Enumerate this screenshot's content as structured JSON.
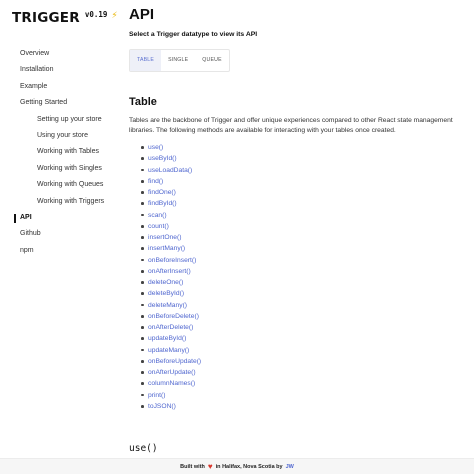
{
  "brand": {
    "name": "TRIGGER",
    "version": "v0.19",
    "icon": "lightning-bolt-icon",
    "icon_glyph": "⚡"
  },
  "sidebar": {
    "items": [
      {
        "label": "Overview",
        "level": "top",
        "active": false
      },
      {
        "label": "Installation",
        "level": "top",
        "active": false
      },
      {
        "label": "Example",
        "level": "top",
        "active": false
      },
      {
        "label": "Getting Started",
        "level": "top",
        "active": false
      },
      {
        "label": "Setting up your store",
        "level": "sub",
        "active": false
      },
      {
        "label": "Using your store",
        "level": "sub",
        "active": false
      },
      {
        "label": "Working with Tables",
        "level": "sub",
        "active": false
      },
      {
        "label": "Working with Singles",
        "level": "sub",
        "active": false
      },
      {
        "label": "Working with Queues",
        "level": "sub",
        "active": false
      },
      {
        "label": "Working with Triggers",
        "level": "sub",
        "active": false
      },
      {
        "label": "API",
        "level": "top",
        "active": true
      },
      {
        "label": "Github",
        "level": "top",
        "active": false
      },
      {
        "label": "npm",
        "level": "top",
        "active": false
      }
    ]
  },
  "main": {
    "title": "API",
    "subtitle": "Select a Trigger datatype to view its API",
    "tabs": [
      {
        "label": "TABLE",
        "active": true
      },
      {
        "label": "SINGLE",
        "active": false
      },
      {
        "label": "QUEUE",
        "active": false
      }
    ],
    "section_title": "Table",
    "section_text": "Tables are the backbone of Trigger and offer unique experiences compared to other React state management libraries. The following methods are available for interacting with your tables once created.",
    "methods": [
      "use()",
      "useById()",
      "useLoadData()",
      "find()",
      "findOne()",
      "findById()",
      "scan()",
      "count()",
      "insertOne()",
      "insertMany()",
      "onBeforeInsert()",
      "onAfterInsert()",
      "deleteOne()",
      "deleteById()",
      "deleteMany()",
      "onBeforeDelete()",
      "onAfterDelete()",
      "updateById()",
      "updateMany()",
      "onBeforeUpdate()",
      "onAfterUpdate()",
      "columnNames()",
      "print()",
      "toJSON()"
    ],
    "code_heading": "use()"
  },
  "footer": {
    "prefix": "Built with",
    "heart_icon": "heart-icon",
    "heart_glyph": "♥",
    "middle": "in Halifax, Nova Scotia by",
    "author": "JW"
  },
  "colors": {
    "link": "#4f66cf",
    "active_tab_bg": "#eef0f8",
    "bolt": "#e8b400",
    "heart": "#d9362b"
  }
}
